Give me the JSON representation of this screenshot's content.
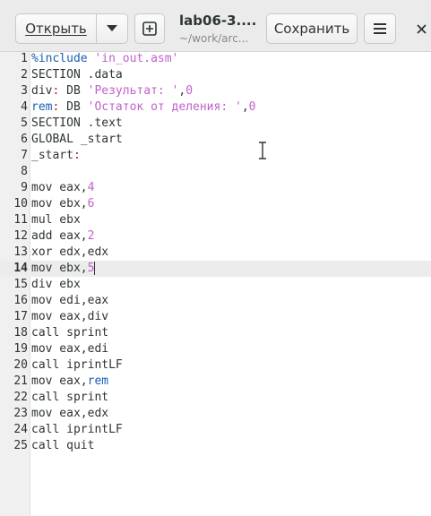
{
  "toolbar": {
    "open_label": "Открыть",
    "open_menu_icon": "chevron-down-icon",
    "new_tab_icon": "new-document-icon",
    "save_label": "Сохранить",
    "menu_icon": "hamburger-menu-icon",
    "close_icon": "close-icon"
  },
  "title": {
    "filename": "lab06-3....",
    "path": "~/work/arc..."
  },
  "editor": {
    "current_line": 14,
    "lines": [
      {
        "n": "1",
        "parts": [
          [
            "pre",
            "%include "
          ],
          [
            "str",
            "'in_out.asm'"
          ]
        ]
      },
      {
        "n": "2",
        "parts": [
          [
            "txt",
            "SECTION .data"
          ]
        ]
      },
      {
        "n": "3",
        "parts": [
          [
            "txt",
            "div"
          ],
          [
            "lbl",
            ":"
          ],
          [
            "txt",
            " DB "
          ],
          [
            "str",
            "'Результат: '"
          ],
          [
            "txt",
            ","
          ],
          [
            "num",
            "0"
          ]
        ]
      },
      {
        "n": "4",
        "parts": [
          [
            "id",
            "rem"
          ],
          [
            "lbl",
            ":"
          ],
          [
            "txt",
            " DB "
          ],
          [
            "str",
            "'Остаток от деления: '"
          ],
          [
            "txt",
            ","
          ],
          [
            "num",
            "0"
          ]
        ]
      },
      {
        "n": "5",
        "parts": [
          [
            "txt",
            "SECTION .text"
          ]
        ]
      },
      {
        "n": "6",
        "parts": [
          [
            "txt",
            "GLOBAL _start"
          ]
        ]
      },
      {
        "n": "7",
        "parts": [
          [
            "txt",
            "_start"
          ],
          [
            "lbl",
            ":"
          ]
        ]
      },
      {
        "n": "8",
        "parts": []
      },
      {
        "n": "9",
        "parts": [
          [
            "txt",
            "mov eax,"
          ],
          [
            "num",
            "4"
          ]
        ]
      },
      {
        "n": "10",
        "parts": [
          [
            "txt",
            "mov ebx,"
          ],
          [
            "num",
            "6"
          ]
        ]
      },
      {
        "n": "11",
        "parts": [
          [
            "txt",
            "mul ebx"
          ]
        ]
      },
      {
        "n": "12",
        "parts": [
          [
            "txt",
            "add eax,"
          ],
          [
            "num",
            "2"
          ]
        ]
      },
      {
        "n": "13",
        "parts": [
          [
            "txt",
            "xor edx,edx"
          ]
        ]
      },
      {
        "n": "14",
        "parts": [
          [
            "txt",
            "mov ebx,"
          ],
          [
            "num",
            "5"
          ]
        ]
      },
      {
        "n": "15",
        "parts": [
          [
            "txt",
            "div ebx"
          ]
        ]
      },
      {
        "n": "16",
        "parts": [
          [
            "txt",
            "mov edi,eax"
          ]
        ]
      },
      {
        "n": "17",
        "parts": [
          [
            "txt",
            "mov eax,div"
          ]
        ]
      },
      {
        "n": "18",
        "parts": [
          [
            "txt",
            "call sprint"
          ]
        ]
      },
      {
        "n": "19",
        "parts": [
          [
            "txt",
            "mov eax,edi"
          ]
        ]
      },
      {
        "n": "20",
        "parts": [
          [
            "txt",
            "call iprintLF"
          ]
        ]
      },
      {
        "n": "21",
        "parts": [
          [
            "txt",
            "mov eax,"
          ],
          [
            "id",
            "rem"
          ]
        ]
      },
      {
        "n": "22",
        "parts": [
          [
            "txt",
            "call sprint"
          ]
        ]
      },
      {
        "n": "23",
        "parts": [
          [
            "txt",
            "mov eax,edx"
          ]
        ]
      },
      {
        "n": "24",
        "parts": [
          [
            "txt",
            "call iprintLF"
          ]
        ]
      },
      {
        "n": "25",
        "parts": [
          [
            "txt",
            "call quit"
          ]
        ]
      }
    ]
  },
  "colors": {
    "number": "#c061cb",
    "string": "#c061cb",
    "preprocessor": "#1a5fb4",
    "label": "#a51d2d",
    "identifier": "#1a5fb4",
    "current_line_bg": "#ececec"
  }
}
